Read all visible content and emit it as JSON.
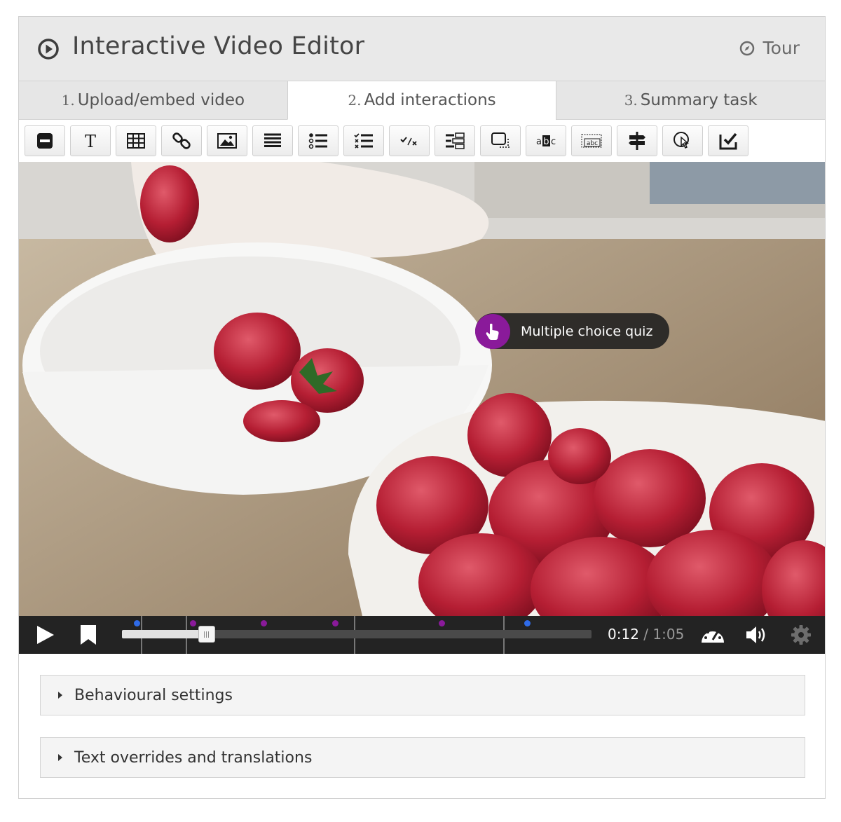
{
  "header": {
    "title": "Interactive Video Editor",
    "tour_label": "Tour"
  },
  "tabs": [
    {
      "num": "1.",
      "label": "Upload/embed video"
    },
    {
      "num": "2.",
      "label": "Add interactions"
    },
    {
      "num": "3.",
      "label": "Summary task"
    }
  ],
  "toolbar": {
    "buttons": [
      "label-icon",
      "text-icon",
      "table-icon",
      "link-icon",
      "image-icon",
      "statements-icon",
      "single-choice-set-icon",
      "multiple-choice-icon",
      "true-false-icon",
      "drag-and-drop-icon",
      "mark-the-words-icon",
      "drag-text-icon",
      "fill-in-blanks-icon",
      "crossroads-icon",
      "navigation-hotspot-icon",
      "free-text-question-icon"
    ]
  },
  "video": {
    "hotspot_label": "Multiple choice quiz",
    "hotspot_icon": "hand-pointer-icon"
  },
  "player": {
    "current_time": "0:12",
    "separator": "/",
    "duration": "1:05",
    "progress_fraction": 0.18
  },
  "accordions": [
    {
      "label": "Behavioural settings"
    },
    {
      "label": "Text overrides and translations"
    }
  ],
  "colors": {
    "accent_purple": "#8a1a9a",
    "marker_blue": "#2f6be8",
    "marker_purple": "#8a1a9a",
    "controls_bg": "#232323"
  }
}
